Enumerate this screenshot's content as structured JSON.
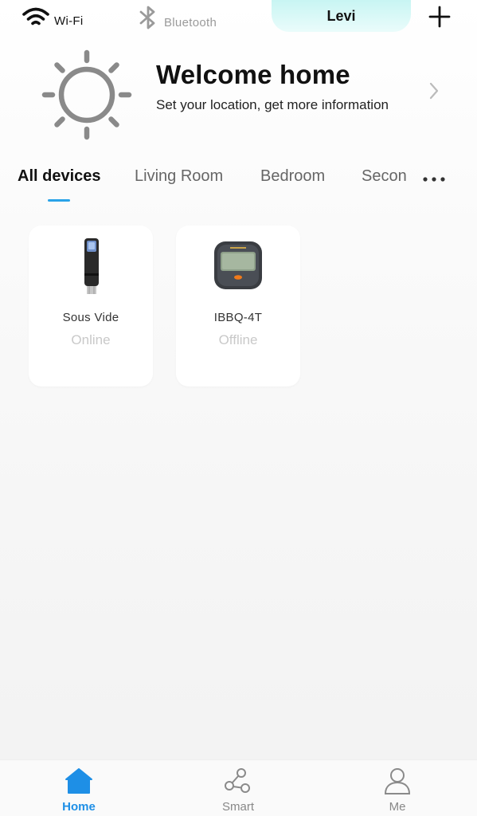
{
  "topbar": {
    "wifi_label": "Wi-Fi",
    "bluetooth_label": "Bluetooth",
    "user_name": "Levi",
    "add_icon": "plus-icon"
  },
  "welcome": {
    "title": "Welcome home",
    "subtitle": "Set your location, get more information",
    "weather_icon": "sun-icon"
  },
  "tabs": [
    {
      "label": "All devices",
      "active": true
    },
    {
      "label": "Living Room",
      "active": false
    },
    {
      "label": "Bedroom",
      "active": false
    },
    {
      "label": "Secon",
      "active": false
    }
  ],
  "devices": [
    {
      "name": "Sous Vide",
      "status": "Online"
    },
    {
      "name": "IBBQ-4T",
      "status": "Offline"
    }
  ],
  "bottom_nav": [
    {
      "label": "Home",
      "icon": "home-icon",
      "active": true
    },
    {
      "label": "Smart",
      "icon": "share-nodes-icon",
      "active": false
    },
    {
      "label": "Me",
      "icon": "person-icon",
      "active": false
    }
  ],
  "colors": {
    "accent": "#1e8fe6",
    "tab_indicator": "#2aa3e8",
    "user_pill": "#c8f5f3",
    "status_text": "#c9c9c9"
  }
}
